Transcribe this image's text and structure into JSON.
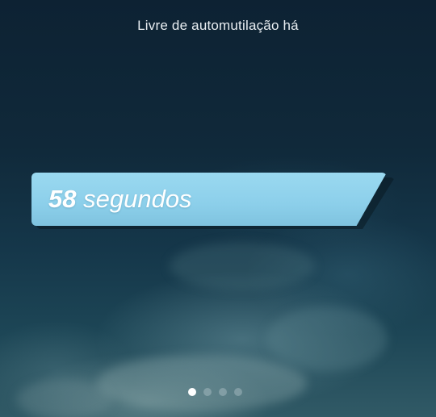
{
  "header": {
    "title": "Livre de automutilação há"
  },
  "counter": {
    "value": "58",
    "unit": "segundos"
  },
  "pager": {
    "total_pages": 4,
    "current_page": 1
  },
  "colors": {
    "badge": "#8ccfea",
    "text": "#ffffff",
    "background": "#122a3a"
  }
}
